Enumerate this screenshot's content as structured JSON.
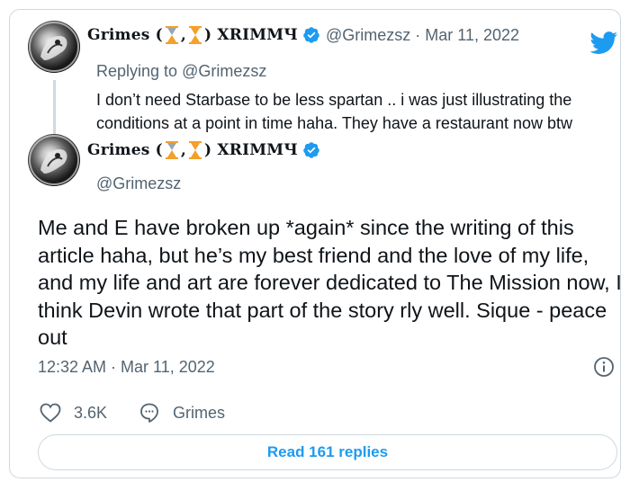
{
  "reply_tweet": {
    "author": {
      "display_name": "Grimes (",
      "display_name_sep": ",",
      "display_name_tail": ") XRIMMЧ",
      "handle": "@Grimezsz"
    },
    "separator": "·",
    "date": "Mar 11, 2022",
    "replying_prefix": "Replying to",
    "replying_to": "@Grimezsz",
    "text": "I don’t need Starbase to be less spartan ..  i was just illustrating the conditions at a point in time haha.  They have a restaurant now btw"
  },
  "main_tweet": {
    "author": {
      "display_name": "Grimes (",
      "display_name_sep": ",",
      "display_name_tail": ") XRIMMЧ",
      "handle": "@Grimezsz"
    },
    "text": "Me and E have broken up *again* since the writing of this article haha, but he’s my best friend and the love of my life, and my life and art are forever dedicated to The Mission now, I think Devin wrote that part of the story rly well.   Sique - peace out",
    "timestamp": "12:32 AM · Mar 11, 2022",
    "likes": "3.6K",
    "reply_label": "Grimes",
    "read_replies": "Read 161 replies"
  },
  "colors": {
    "accent": "#1d9bf0",
    "secondary_text": "#536471",
    "border": "#cfd9de",
    "hourglass": "#f4a02a"
  },
  "icons": [
    "twitter-bird-icon",
    "verified-icon",
    "hourglass-icon",
    "info-icon",
    "heart-icon",
    "comment-icon"
  ]
}
